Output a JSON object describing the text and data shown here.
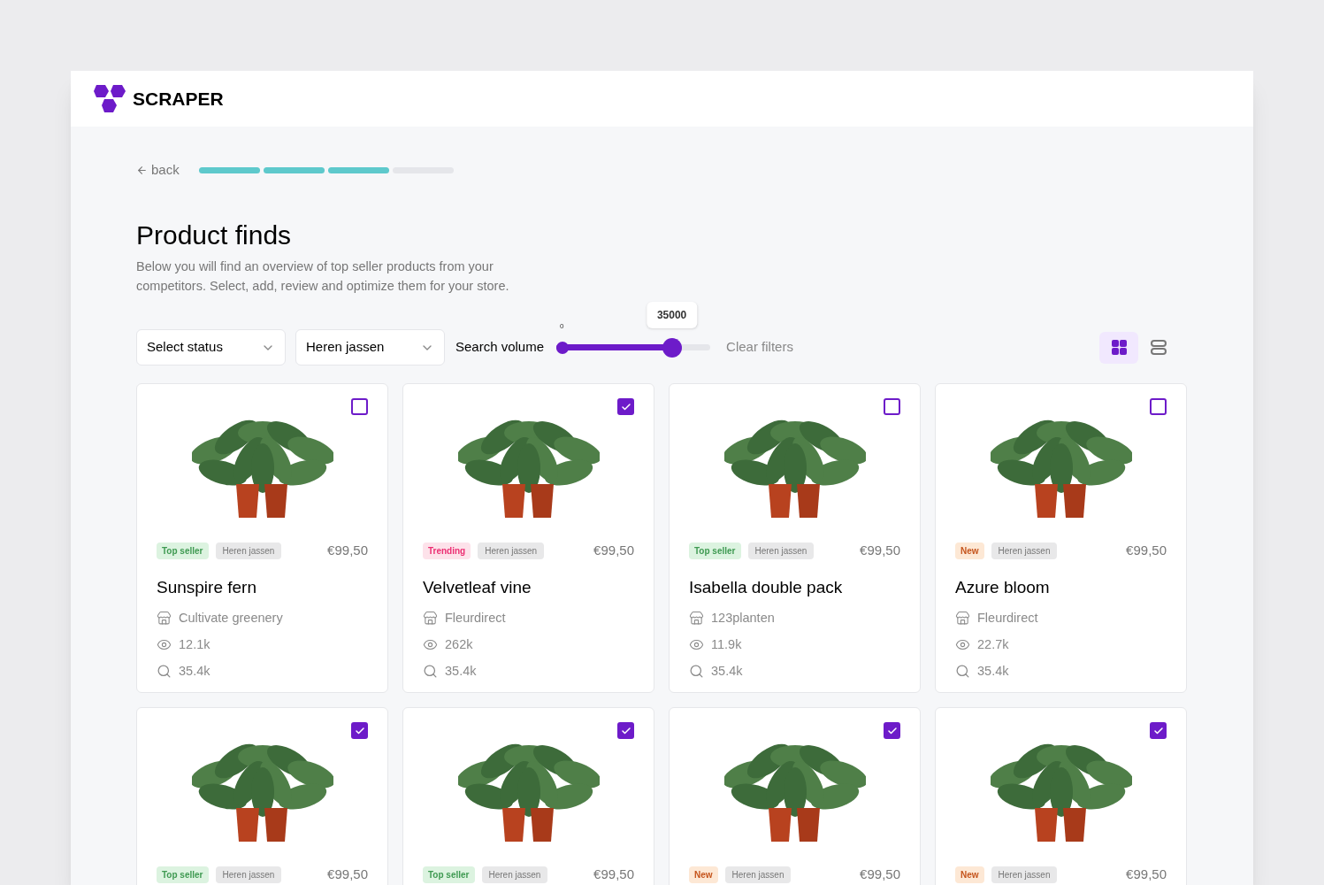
{
  "brand": {
    "name": "SCRAPER"
  },
  "nav": {
    "back": "back",
    "steps": [
      {
        "done": true
      },
      {
        "done": true
      },
      {
        "done": true
      },
      {
        "done": false
      }
    ]
  },
  "title": "Product finds",
  "description": "Below you will find an overview of top seller products from your competitors. Select, add, review and optimize them for your store.",
  "filters": {
    "status": {
      "value": "Select status"
    },
    "category": {
      "value": "Heren jassen"
    },
    "search_volume": {
      "label": "Search volume",
      "min_label": "0",
      "tooltip": "35000",
      "level": 0.75
    },
    "clear": "Clear filters"
  },
  "view_toggle": [
    {
      "kind": "grid",
      "selected": true
    },
    {
      "kind": "list",
      "selected": false
    }
  ],
  "products": [
    {
      "checked": false,
      "status": {
        "kind": "top_seller",
        "label": "Top seller"
      },
      "category": "Heren jassen",
      "price": "€99,50",
      "name": "Sunspire fern",
      "shop": "Cultivate greenery",
      "views": "12.1k",
      "searches": "35.4k"
    },
    {
      "checked": true,
      "status": {
        "kind": "trending",
        "label": "Trending"
      },
      "category": "Heren jassen",
      "price": "€99,50",
      "name": "Velvetleaf vine",
      "shop": "Fleurdirect",
      "views": "262k",
      "searches": "35.4k"
    },
    {
      "checked": false,
      "status": {
        "kind": "top_seller",
        "label": "Top seller"
      },
      "category": "Heren jassen",
      "price": "€99,50",
      "name": "Isabella double pack",
      "shop": "123planten",
      "views": "11.9k",
      "searches": "35.4k"
    },
    {
      "checked": false,
      "status": {
        "kind": "new",
        "label": "New"
      },
      "category": "Heren jassen",
      "price": "€99,50",
      "name": "Azure bloom",
      "shop": "Fleurdirect",
      "views": "22.7k",
      "searches": "35.4k"
    },
    {
      "checked": true,
      "status": {
        "kind": "top_seller",
        "label": "Top seller"
      },
      "category": "Heren jassen",
      "price": "€99,50"
    },
    {
      "checked": true,
      "status": {
        "kind": "top_seller",
        "label": "Top seller"
      },
      "category": "Heren jassen",
      "price": "€99,50"
    },
    {
      "checked": true,
      "status": {
        "kind": "new",
        "label": "New"
      },
      "category": "Heren jassen",
      "price": "€99,50"
    },
    {
      "checked": true,
      "status": {
        "kind": "new",
        "label": "New"
      },
      "category": "Heren jassen",
      "price": "€99,50"
    }
  ]
}
